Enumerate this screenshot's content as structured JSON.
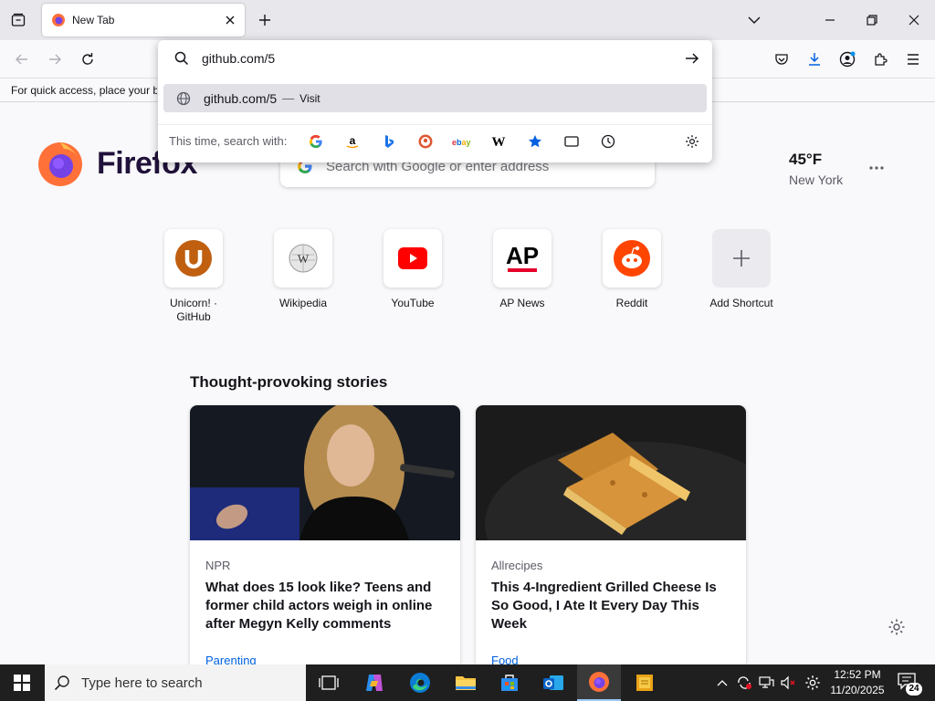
{
  "browser": {
    "tab": {
      "title": "New Tab"
    },
    "bookmarks_hint": "For quick access, place your bo"
  },
  "urlbar": {
    "value": "github.com/5",
    "result": {
      "url": "github.com/5",
      "separator": "—",
      "action": "Visit"
    },
    "engines_label": "This time, search with:",
    "engines": [
      "google-icon",
      "amazon-icon",
      "bing-icon",
      "duckduckgo-icon",
      "ebay-icon",
      "wikipedia-icon",
      "bookmarks-icon",
      "tabs-icon",
      "history-icon"
    ]
  },
  "newtab": {
    "logo_text": "Firefox",
    "search_placeholder": "Search with Google or enter address",
    "weather": {
      "temp": "45°F",
      "city": "New York"
    },
    "shortcuts": [
      {
        "label": "Unicorn! · GitHub",
        "icon": "unicorn-icon"
      },
      {
        "label": "Wikipedia",
        "icon": "wikipedia-icon"
      },
      {
        "label": "YouTube",
        "icon": "youtube-icon"
      },
      {
        "label": "AP News",
        "icon": "ap-news-icon"
      },
      {
        "label": "Reddit",
        "icon": "reddit-icon"
      },
      {
        "label": "Add Shortcut",
        "icon": "plus-icon"
      }
    ],
    "stories_heading": "Thought-provoking stories",
    "stories": [
      {
        "source": "NPR",
        "title": "What does 15 look like? Teens and former child actors weigh in online after Megyn Kelly comments",
        "category": "Parenting"
      },
      {
        "source": "Allrecipes",
        "title": "This 4-Ingredient Grilled Cheese Is So Good, I Ate It Every Day This Week",
        "category": "Food"
      }
    ]
  },
  "taskbar": {
    "search_placeholder": "Type here to search",
    "time": "12:52 PM",
    "date": "11/20/2025",
    "notification_count": "24"
  },
  "colors": {
    "accent": "#0061e0",
    "firefox_purple": "#20123a",
    "taskbar": "#1f1f1f"
  }
}
